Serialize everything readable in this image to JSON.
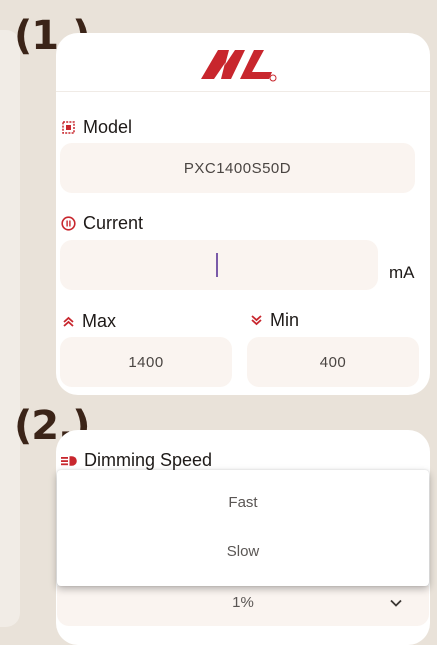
{
  "steps": {
    "one": "(1.)",
    "two": "(2.)"
  },
  "model": {
    "label": "Model",
    "value": "PXC1400S50D",
    "icon": "chip-icon"
  },
  "current": {
    "label": "Current",
    "value": "",
    "unit": "mA",
    "icon": "current-icon"
  },
  "max": {
    "label": "Max",
    "value": "1400",
    "icon": "double-chevron-up-icon"
  },
  "min": {
    "label": "Min",
    "value": "400",
    "icon": "double-chevron-down-icon"
  },
  "dimming": {
    "label": "Dimming Speed",
    "icon": "dimming-icon",
    "options": [
      "Fast",
      "Slow"
    ],
    "selected": "1%"
  },
  "colors": {
    "accent": "#c8262d",
    "field": "#faf4f0",
    "background": "#e9e2d9",
    "label_dark": "#3b2418"
  }
}
